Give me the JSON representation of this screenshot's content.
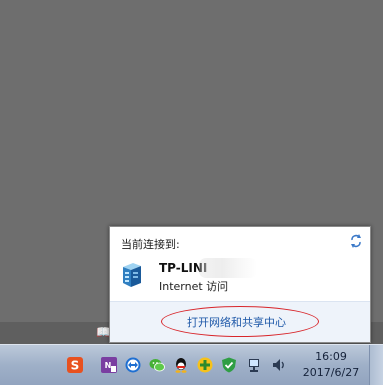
{
  "flyout": {
    "connected_label": "当前连接到:",
    "network_name": "TP-LINI",
    "network_status": "Internet 访问",
    "open_center_link": "打开网络和共享中心"
  },
  "background_strip": {
    "glyph": "📖"
  },
  "taskbar": {
    "tray_icons": [
      "sogou-input-icon",
      "onenote-icon",
      "teamviewer-icon",
      "wechat-icon",
      "qq-icon",
      "plus-app-icon",
      "security-shield-icon",
      "network-icon",
      "volume-icon"
    ],
    "time": "16:09",
    "date": "2017/6/27"
  },
  "colors": {
    "desktop": "#6e6e6e",
    "link": "#1e58a8",
    "annotation": "#d8262b"
  }
}
